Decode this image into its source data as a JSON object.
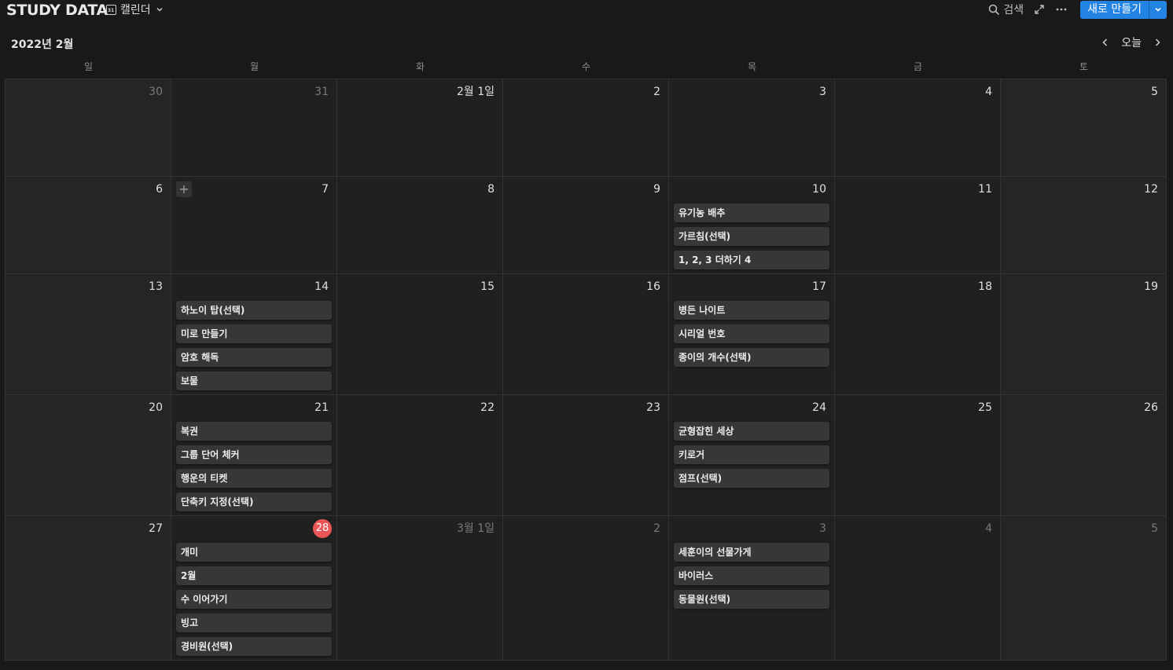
{
  "header": {
    "title": "STUDY DATA",
    "view_label": "캘린더",
    "search_label": "검색",
    "new_label": "새로 만들기",
    "accent": "#2383e2"
  },
  "calendar": {
    "month_label": "2022년 2월",
    "today_label": "오늘",
    "weekdays": [
      "일",
      "월",
      "화",
      "수",
      "목",
      "금",
      "토"
    ],
    "today_color": "#eb5757",
    "weeks": [
      [
        {
          "day": "30",
          "dim": true,
          "events": []
        },
        {
          "day": "31",
          "dim": true,
          "events": []
        },
        {
          "day": "2월 1일",
          "dim": false,
          "events": []
        },
        {
          "day": "2",
          "dim": false,
          "events": []
        },
        {
          "day": "3",
          "dim": false,
          "events": []
        },
        {
          "day": "4",
          "dim": false,
          "events": []
        },
        {
          "day": "5",
          "dim": false,
          "events": []
        }
      ],
      [
        {
          "day": "6",
          "dim": false,
          "events": []
        },
        {
          "day": "7",
          "dim": false,
          "hover_add": true,
          "events": []
        },
        {
          "day": "8",
          "dim": false,
          "events": []
        },
        {
          "day": "9",
          "dim": false,
          "events": []
        },
        {
          "day": "10",
          "dim": false,
          "events": [
            "유기농 배추",
            "가르침(선택)",
            "1, 2, 3 더하기 4"
          ]
        },
        {
          "day": "11",
          "dim": false,
          "events": []
        },
        {
          "day": "12",
          "dim": false,
          "events": []
        }
      ],
      [
        {
          "day": "13",
          "dim": false,
          "events": []
        },
        {
          "day": "14",
          "dim": false,
          "events": [
            "하노이 탑(선택)",
            "미로 만들기",
            "암호 해독",
            "보물"
          ]
        },
        {
          "day": "15",
          "dim": false,
          "events": []
        },
        {
          "day": "16",
          "dim": false,
          "events": []
        },
        {
          "day": "17",
          "dim": false,
          "events": [
            "병든 나이트",
            "시리얼 번호",
            "종이의 개수(선택)"
          ]
        },
        {
          "day": "18",
          "dim": false,
          "events": []
        },
        {
          "day": "19",
          "dim": false,
          "events": []
        }
      ],
      [
        {
          "day": "20",
          "dim": false,
          "events": []
        },
        {
          "day": "21",
          "dim": false,
          "events": [
            "복권",
            "그룹 단어 체커",
            "행운의 티켓",
            "단축키 지정(선택)"
          ]
        },
        {
          "day": "22",
          "dim": false,
          "events": []
        },
        {
          "day": "23",
          "dim": false,
          "events": []
        },
        {
          "day": "24",
          "dim": false,
          "events": [
            "균형잡힌 세상",
            "키로거",
            "점프(선택)"
          ]
        },
        {
          "day": "25",
          "dim": false,
          "events": []
        },
        {
          "day": "26",
          "dim": false,
          "events": []
        }
      ],
      [
        {
          "day": "27",
          "dim": false,
          "events": []
        },
        {
          "day": "28",
          "dim": false,
          "today": true,
          "events": [
            "개미",
            "2월",
            "수 이어가기",
            "빙고",
            "경비원(선택)"
          ]
        },
        {
          "day": "3월 1일",
          "dim": true,
          "events": []
        },
        {
          "day": "2",
          "dim": true,
          "events": []
        },
        {
          "day": "3",
          "dim": true,
          "events": [
            "세훈이의 선물가게",
            "바이러스",
            "동물원(선택)"
          ]
        },
        {
          "day": "4",
          "dim": true,
          "events": []
        },
        {
          "day": "5",
          "dim": true,
          "events": []
        }
      ]
    ]
  }
}
